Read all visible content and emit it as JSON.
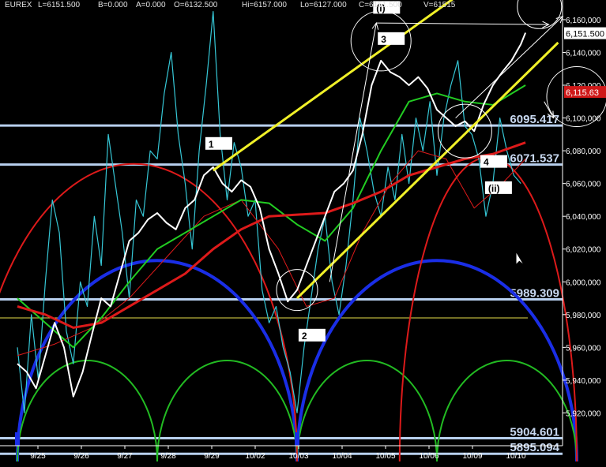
{
  "header": {
    "symbol": "EUREX",
    "last": "L=6151.500",
    "bid": "B=0.000",
    "ask": "A=0.000",
    "open": "O=6132.500",
    "high": "Hi=6157.000",
    "low": "Lo=6127.000",
    "close": "C=6151.500",
    "volume": "V=61515"
  },
  "colors": {
    "background": "#000000",
    "price": "#ffffff",
    "oscillator": "#36c7d6",
    "trendline": "#f0f028",
    "red_ma": "#dd1a1a",
    "green_ma": "#22cc22",
    "blue_cycle": "#1a2ee6",
    "green_cycle": "#22bb22",
    "level_line": "#b8d0ee",
    "last_price_tag": "#ffffff",
    "red_price_tag": "#d01818"
  },
  "chart_data": {
    "type": "line",
    "instrument": "EUREX",
    "y_range": [
      5900,
      6172
    ],
    "y_ticks": [
      "6,160,000",
      "6,140,000",
      "6,120,000",
      "6,100,000",
      "6,080,000",
      "6,060,000",
      "6,040,000",
      "6,020,000",
      "6,000,000",
      "5,980,000",
      "5,960,000",
      "5,940,000",
      "5,920,000"
    ],
    "x_labels": [
      "9/25",
      "9/26",
      "9/27",
      "9/28",
      "9/29",
      "10/02",
      "10/03",
      "10/04",
      "10/05",
      "10/06",
      "10/09",
      "10/10"
    ],
    "last_price_label": "6,151.500",
    "red_price_label": "6,115.63",
    "levels": [
      {
        "label": "6095.417",
        "value": 6095.417
      },
      {
        "label": "6071.537",
        "value": 6071.537
      },
      {
        "label": "5989.309",
        "value": 5989.309
      },
      {
        "label": "5904.601",
        "value": 5904.601
      },
      {
        "label": "5895.094",
        "value": 5895.094
      }
    ],
    "thin_yellow_level": 5978,
    "wave_labels": [
      "1",
      "2",
      "3",
      "4",
      "(i)",
      "(ii)"
    ],
    "price_path": [
      [
        0.0,
        5950
      ],
      [
        0.2,
        5945
      ],
      [
        0.4,
        5935
      ],
      [
        0.6,
        5955
      ],
      [
        0.8,
        5975
      ],
      [
        1.0,
        5960
      ],
      [
        1.2,
        5930
      ],
      [
        1.4,
        5945
      ],
      [
        1.6,
        5968
      ],
      [
        1.8,
        5990
      ],
      [
        2.0,
        5985
      ],
      [
        2.2,
        6005
      ],
      [
        2.4,
        6025
      ],
      [
        2.6,
        6030
      ],
      [
        2.8,
        6038
      ],
      [
        3.0,
        6042
      ],
      [
        3.2,
        6036
      ],
      [
        3.4,
        6032
      ],
      [
        3.6,
        6045
      ],
      [
        3.8,
        6050
      ],
      [
        4.0,
        6065
      ],
      [
        4.2,
        6070
      ],
      [
        4.4,
        6060
      ],
      [
        4.6,
        6055
      ],
      [
        4.8,
        6062
      ],
      [
        5.0,
        6058
      ],
      [
        5.2,
        6045
      ],
      [
        5.4,
        6020
      ],
      [
        5.6,
        6005
      ],
      [
        5.8,
        5988
      ],
      [
        6.0,
        5995
      ],
      [
        6.2,
        6010
      ],
      [
        6.4,
        6025
      ],
      [
        6.6,
        6040
      ],
      [
        6.8,
        6055
      ],
      [
        7.0,
        6060
      ],
      [
        7.2,
        6068
      ],
      [
        7.4,
        6090
      ],
      [
        7.6,
        6120
      ],
      [
        7.8,
        6135
      ],
      [
        8.0,
        6128
      ],
      [
        8.2,
        6125
      ],
      [
        8.4,
        6120
      ],
      [
        8.6,
        6125
      ],
      [
        8.8,
        6118
      ],
      [
        9.0,
        6105
      ],
      [
        9.2,
        6100
      ],
      [
        9.4,
        6095
      ],
      [
        9.6,
        6098
      ],
      [
        9.8,
        6092
      ],
      [
        10.0,
        6108
      ],
      [
        10.2,
        6120
      ],
      [
        10.4,
        6128
      ],
      [
        10.6,
        6135
      ],
      [
        10.8,
        6145
      ],
      [
        10.9,
        6152
      ]
    ],
    "oscillator_path": [
      [
        0.0,
        5960
      ],
      [
        0.15,
        5920
      ],
      [
        0.3,
        5980
      ],
      [
        0.45,
        5940
      ],
      [
        0.6,
        6000
      ],
      [
        0.75,
        6050
      ],
      [
        0.9,
        6030
      ],
      [
        1.05,
        5970
      ],
      [
        1.2,
        5950
      ],
      [
        1.35,
        6000
      ],
      [
        1.5,
        5985
      ],
      [
        1.65,
        6040
      ],
      [
        1.8,
        6010
      ],
      [
        1.95,
        6090
      ],
      [
        2.1,
        6060
      ],
      [
        2.25,
        6030
      ],
      [
        2.4,
        5990
      ],
      [
        2.55,
        6050
      ],
      [
        2.7,
        6040
      ],
      [
        2.85,
        6080
      ],
      [
        3.0,
        6075
      ],
      [
        3.15,
        6115
      ],
      [
        3.3,
        6140
      ],
      [
        3.45,
        6090
      ],
      [
        3.6,
        6060
      ],
      [
        3.75,
        6020
      ],
      [
        3.9,
        6080
      ],
      [
        4.05,
        6120
      ],
      [
        4.2,
        6165
      ],
      [
        4.35,
        6090
      ],
      [
        4.5,
        6050
      ],
      [
        4.65,
        6085
      ],
      [
        4.8,
        6070
      ],
      [
        4.95,
        6040
      ],
      [
        5.1,
        6050
      ],
      [
        5.25,
        5995
      ],
      [
        5.4,
        5975
      ],
      [
        5.55,
        5985
      ],
      [
        5.7,
        5960
      ],
      [
        5.85,
        5945
      ],
      [
        6.0,
        5920
      ],
      [
        6.15,
        5960
      ],
      [
        6.3,
        5990
      ],
      [
        6.45,
        6020
      ],
      [
        6.6,
        6040
      ],
      [
        6.75,
        6000
      ],
      [
        6.9,
        5980
      ],
      [
        7.05,
        6010
      ],
      [
        7.2,
        6050
      ],
      [
        7.35,
        6100
      ],
      [
        7.5,
        6080
      ],
      [
        7.65,
        6055
      ],
      [
        7.8,
        6040
      ],
      [
        7.95,
        6070
      ],
      [
        8.1,
        6050
      ],
      [
        8.25,
        6090
      ],
      [
        8.4,
        6060
      ],
      [
        8.55,
        6100
      ],
      [
        8.7,
        6080
      ],
      [
        8.85,
        6110
      ],
      [
        9.0,
        6065
      ],
      [
        9.15,
        6100
      ],
      [
        9.3,
        6120
      ],
      [
        9.45,
        6135
      ],
      [
        9.6,
        6095
      ],
      [
        9.75,
        6090
      ],
      [
        9.9,
        6075
      ],
      [
        10.05,
        6040
      ],
      [
        10.2,
        6060
      ],
      [
        10.35,
        6100
      ],
      [
        10.5,
        6080
      ],
      [
        10.65,
        6065
      ],
      [
        10.8,
        6060
      ]
    ],
    "red_ma_path": [
      [
        0.0,
        5985
      ],
      [
        0.6,
        5980
      ],
      [
        1.2,
        5972
      ],
      [
        1.8,
        5975
      ],
      [
        2.4,
        5985
      ],
      [
        3.0,
        5995
      ],
      [
        3.6,
        6005
      ],
      [
        4.2,
        6020
      ],
      [
        4.8,
        6032
      ],
      [
        5.4,
        6040
      ],
      [
        6.0,
        6041
      ],
      [
        6.6,
        6042
      ],
      [
        7.2,
        6048
      ],
      [
        7.8,
        6055
      ],
      [
        8.4,
        6065
      ],
      [
        9.0,
        6070
      ],
      [
        9.6,
        6075
      ],
      [
        10.2,
        6078
      ],
      [
        10.9,
        6085
      ]
    ],
    "green_ma_path": [
      [
        0.0,
        5990
      ],
      [
        0.6,
        5975
      ],
      [
        1.2,
        5960
      ],
      [
        1.8,
        5978
      ],
      [
        2.4,
        6000
      ],
      [
        3.0,
        6020
      ],
      [
        3.6,
        6030
      ],
      [
        4.2,
        6040
      ],
      [
        4.8,
        6050
      ],
      [
        5.4,
        6048
      ],
      [
        6.0,
        6035
      ],
      [
        6.6,
        6025
      ],
      [
        7.2,
        6045
      ],
      [
        7.8,
        6080
      ],
      [
        8.4,
        6110
      ],
      [
        9.0,
        6115
      ],
      [
        9.6,
        6110
      ],
      [
        10.2,
        6108
      ],
      [
        10.9,
        6120
      ]
    ],
    "thin_red_path": [
      [
        0.0,
        5955
      ],
      [
        0.8,
        5962
      ],
      [
        1.6,
        5972
      ],
      [
        2.4,
        5990
      ],
      [
        3.2,
        6015
      ],
      [
        4.0,
        6040
      ],
      [
        4.8,
        6050
      ],
      [
        5.6,
        6020
      ],
      [
        6.2,
        5985
      ],
      [
        6.8,
        5990
      ],
      [
        7.4,
        6030
      ],
      [
        8.0,
        6060
      ],
      [
        8.6,
        6080
      ],
      [
        9.2,
        6075
      ],
      [
        9.8,
        6045
      ],
      [
        10.4,
        6060
      ],
      [
        10.9,
        6075
      ]
    ],
    "big_red_arc": {
      "x_start": -1.0,
      "x_end": 6.0,
      "peak": 6072
    },
    "right_red_arc": {
      "x_start": 8.2,
      "x_end": 12.0,
      "peak": 6076
    },
    "blue_cycles": [
      {
        "x_start": 0.0,
        "x_end": 6.0,
        "peak": 6013
      },
      {
        "x_start": 6.0,
        "x_end": 12.0,
        "peak": 6013
      }
    ],
    "green_cycles": [
      {
        "x_start": 0.0,
        "x_end": 3.0,
        "peak": 5952
      },
      {
        "x_start": 3.0,
        "x_end": 6.0,
        "peak": 5952
      },
      {
        "x_start": 6.0,
        "x_end": 9.0,
        "peak": 5952
      },
      {
        "x_start": 9.0,
        "x_end": 12.0,
        "peak": 5952
      }
    ],
    "yellow_trendlines": [
      [
        [
          4.2,
          6068
        ],
        [
          10.0,
          6186
        ]
      ],
      [
        [
          6.0,
          5990
        ],
        [
          11.6,
          6146
        ]
      ]
    ],
    "white_arrows": [
      [
        [
          6.7,
          6000
        ],
        [
          7.7,
          6158
        ]
      ],
      [
        [
          7.7,
          6158
        ],
        [
          11.4,
          6157
        ]
      ],
      [
        [
          9.4,
          6100
        ],
        [
          11.7,
          6162
        ]
      ],
      [
        [
          11.3,
          6110
        ],
        [
          11.5,
          6100
        ]
      ]
    ],
    "circles": [
      {
        "x": 6.0,
        "y": 5995,
        "r": 26
      },
      {
        "x": 7.8,
        "y": 6147,
        "r": 38
      },
      {
        "x": 9.6,
        "y": 6092,
        "r": 34
      },
      {
        "x": 11.2,
        "y": 6168,
        "r": 28
      },
      {
        "x": 12.0,
        "y": 6113,
        "r": 38
      }
    ],
    "wave_positions": [
      {
        "label": "1",
        "x": 4.1,
        "y": 6084
      },
      {
        "label": "2",
        "x": 6.1,
        "y": 5967
      },
      {
        "label": "3",
        "x": 7.8,
        "y": 6148
      },
      {
        "label": "4",
        "x": 10.0,
        "y": 6073
      },
      {
        "label": "(i)",
        "x": 7.7,
        "y": 6167
      },
      {
        "label": "(ii)",
        "x": 10.1,
        "y": 6057
      }
    ],
    "cursor": {
      "x": 10.7,
      "y": 6018
    },
    "grid": false,
    "legend": "none"
  }
}
